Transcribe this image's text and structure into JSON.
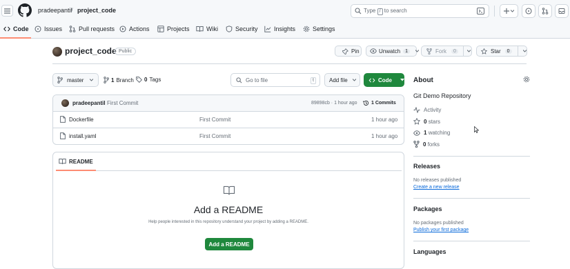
{
  "header": {
    "owner": "pradeepantil",
    "separator": "/",
    "repo": "project_code",
    "search": {
      "text_before": "Type",
      "key": "/",
      "text_after": "to search"
    }
  },
  "nav": {
    "tabs": [
      {
        "label": "Code",
        "icon": "code-icon",
        "active": true
      },
      {
        "label": "Issues",
        "icon": "issue-icon"
      },
      {
        "label": "Pull requests",
        "icon": "pull-request-icon"
      },
      {
        "label": "Actions",
        "icon": "play-icon"
      },
      {
        "label": "Projects",
        "icon": "table-icon"
      },
      {
        "label": "Wiki",
        "icon": "book-icon"
      },
      {
        "label": "Security",
        "icon": "shield-icon"
      },
      {
        "label": "Insights",
        "icon": "graph-icon"
      },
      {
        "label": "Settings",
        "icon": "gear-icon"
      }
    ]
  },
  "repo_header": {
    "name": "project_code",
    "visibility": "Public",
    "pin_label": "Pin",
    "watch_label": "Unwatch",
    "watch_count": "1",
    "fork_label": "Fork",
    "fork_count": "0",
    "star_label": "Star",
    "star_count": "0"
  },
  "toolbar": {
    "branch": "master",
    "branch_count": "1",
    "branch_label": "Branch",
    "tag_count": "0",
    "tag_label": "Tags",
    "goto_placeholder": "Go to file",
    "goto_key": "t",
    "add_file_label": "Add file",
    "code_label": "Code"
  },
  "latest_commit": {
    "author": "pradeepantil",
    "message": "First Commit",
    "meta": "89898cb · 1 hour ago",
    "commits_label": "1 Commits"
  },
  "files": [
    {
      "name": "Dockerfile",
      "commit": "First Commit",
      "time": "1 hour ago"
    },
    {
      "name": "install.yaml",
      "commit": "First Commit",
      "time": "1 hour ago"
    }
  ],
  "readme": {
    "tab_label": "README",
    "heading": "Add a README",
    "description": "Help people interested in this repository understand your project by adding a README.",
    "button": "Add a README"
  },
  "sidebar": {
    "about_title": "About",
    "description": "Git Demo Repository",
    "activity": "Activity",
    "stars_count": "0",
    "stars_label": "stars",
    "watching_count": "1",
    "watching_label": "watching",
    "forks_count": "0",
    "forks_label": "forks",
    "releases_title": "Releases",
    "releases_none": "No releases published",
    "releases_link": "Create a new release",
    "packages_title": "Packages",
    "packages_none": "No packages published",
    "packages_link": "Publish your first package",
    "languages_title": "Languages"
  },
  "colors": {
    "accent_green": "#1f883d",
    "link_blue": "#0969da",
    "active_tab": "#fd8c73"
  }
}
